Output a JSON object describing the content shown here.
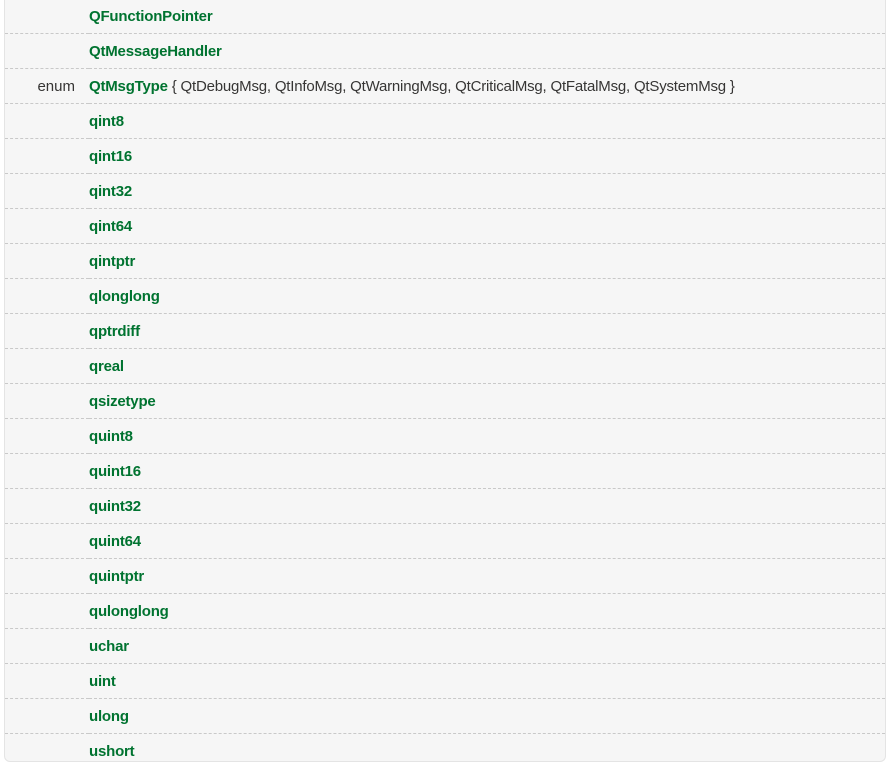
{
  "types": [
    {
      "prefix": "",
      "name": "QFunctionPointer",
      "suffix": ""
    },
    {
      "prefix": "",
      "name": "QtMessageHandler",
      "suffix": ""
    },
    {
      "prefix": "enum",
      "name": "QtMsgType",
      "suffix": " { QtDebugMsg, QtInfoMsg, QtWarningMsg, QtCriticalMsg, QtFatalMsg, QtSystemMsg }"
    },
    {
      "prefix": "",
      "name": "qint8",
      "suffix": ""
    },
    {
      "prefix": "",
      "name": "qint16",
      "suffix": ""
    },
    {
      "prefix": "",
      "name": "qint32",
      "suffix": ""
    },
    {
      "prefix": "",
      "name": "qint64",
      "suffix": ""
    },
    {
      "prefix": "",
      "name": "qintptr",
      "suffix": ""
    },
    {
      "prefix": "",
      "name": "qlonglong",
      "suffix": ""
    },
    {
      "prefix": "",
      "name": "qptrdiff",
      "suffix": ""
    },
    {
      "prefix": "",
      "name": "qreal",
      "suffix": ""
    },
    {
      "prefix": "",
      "name": "qsizetype",
      "suffix": ""
    },
    {
      "prefix": "",
      "name": "quint8",
      "suffix": ""
    },
    {
      "prefix": "",
      "name": "quint16",
      "suffix": ""
    },
    {
      "prefix": "",
      "name": "quint32",
      "suffix": ""
    },
    {
      "prefix": "",
      "name": "quint64",
      "suffix": ""
    },
    {
      "prefix": "",
      "name": "quintptr",
      "suffix": ""
    },
    {
      "prefix": "",
      "name": "qulonglong",
      "suffix": ""
    },
    {
      "prefix": "",
      "name": "uchar",
      "suffix": ""
    },
    {
      "prefix": "",
      "name": "uint",
      "suffix": ""
    },
    {
      "prefix": "",
      "name": "ulong",
      "suffix": ""
    },
    {
      "prefix": "",
      "name": "ushort",
      "suffix": ""
    }
  ],
  "colors": {
    "link": "#007330",
    "text": "#363534",
    "panel_background": "#f6f6f6",
    "row_separator": "#c9c9c9"
  }
}
